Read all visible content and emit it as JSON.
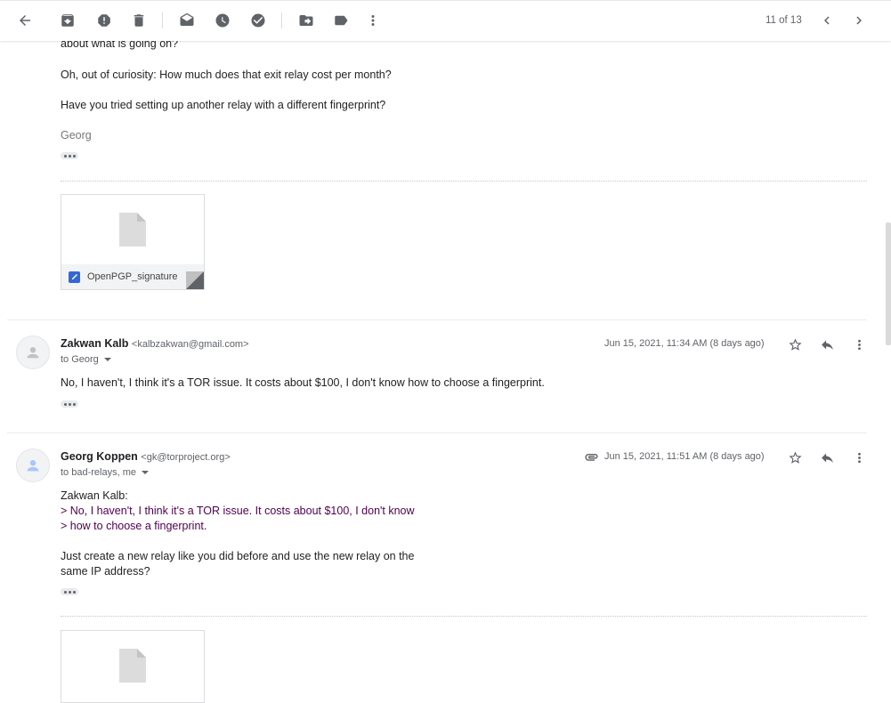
{
  "toolbar": {
    "pager_text": "11 of 13",
    "icons": [
      "back-arrow-icon",
      "archive-icon",
      "report-spam-icon",
      "delete-icon",
      "mark-unread-icon",
      "snooze-icon",
      "add-task-icon",
      "move-to-icon",
      "label-icon",
      "more-vert-icon",
      "prev-chevron-icon",
      "next-chevron-icon"
    ]
  },
  "message_prev": {
    "line_cut": "about what is going on?",
    "line1": "Oh, out of curiosity: How much does that exit relay cost per month?",
    "line2": "Have you tried setting up another relay with a different fingerprint?",
    "signature": "Georg",
    "attachment_name": "OpenPGP_signature"
  },
  "message_zakwan": {
    "sender_name": "Zakwan Kalb",
    "sender_email": "<kalbzakwan@gmail.com>",
    "to_text": "to Georg",
    "date": "Jun 15, 2021, 11:34 AM (8 days ago)",
    "body": "No, I haven't, I think it's a TOR issue. It costs about $100, I don't know how to choose a fingerprint."
  },
  "message_georg": {
    "sender_name": "Georg Koppen",
    "sender_email": "<gk@torproject.org>",
    "to_text": "to bad-relays, me",
    "date": "Jun 15, 2021, 11:51 AM (8 days ago)",
    "quote_header": "Zakwan Kalb:",
    "quote_line1": "> No, I haven't, I think it's a TOR issue. It costs about $100, I don't know",
    "quote_line2": "> how to choose a fingerprint.",
    "body_line1": "Just create a new relay like you did before and use the new relay on the",
    "body_line2": "same IP address?"
  }
}
